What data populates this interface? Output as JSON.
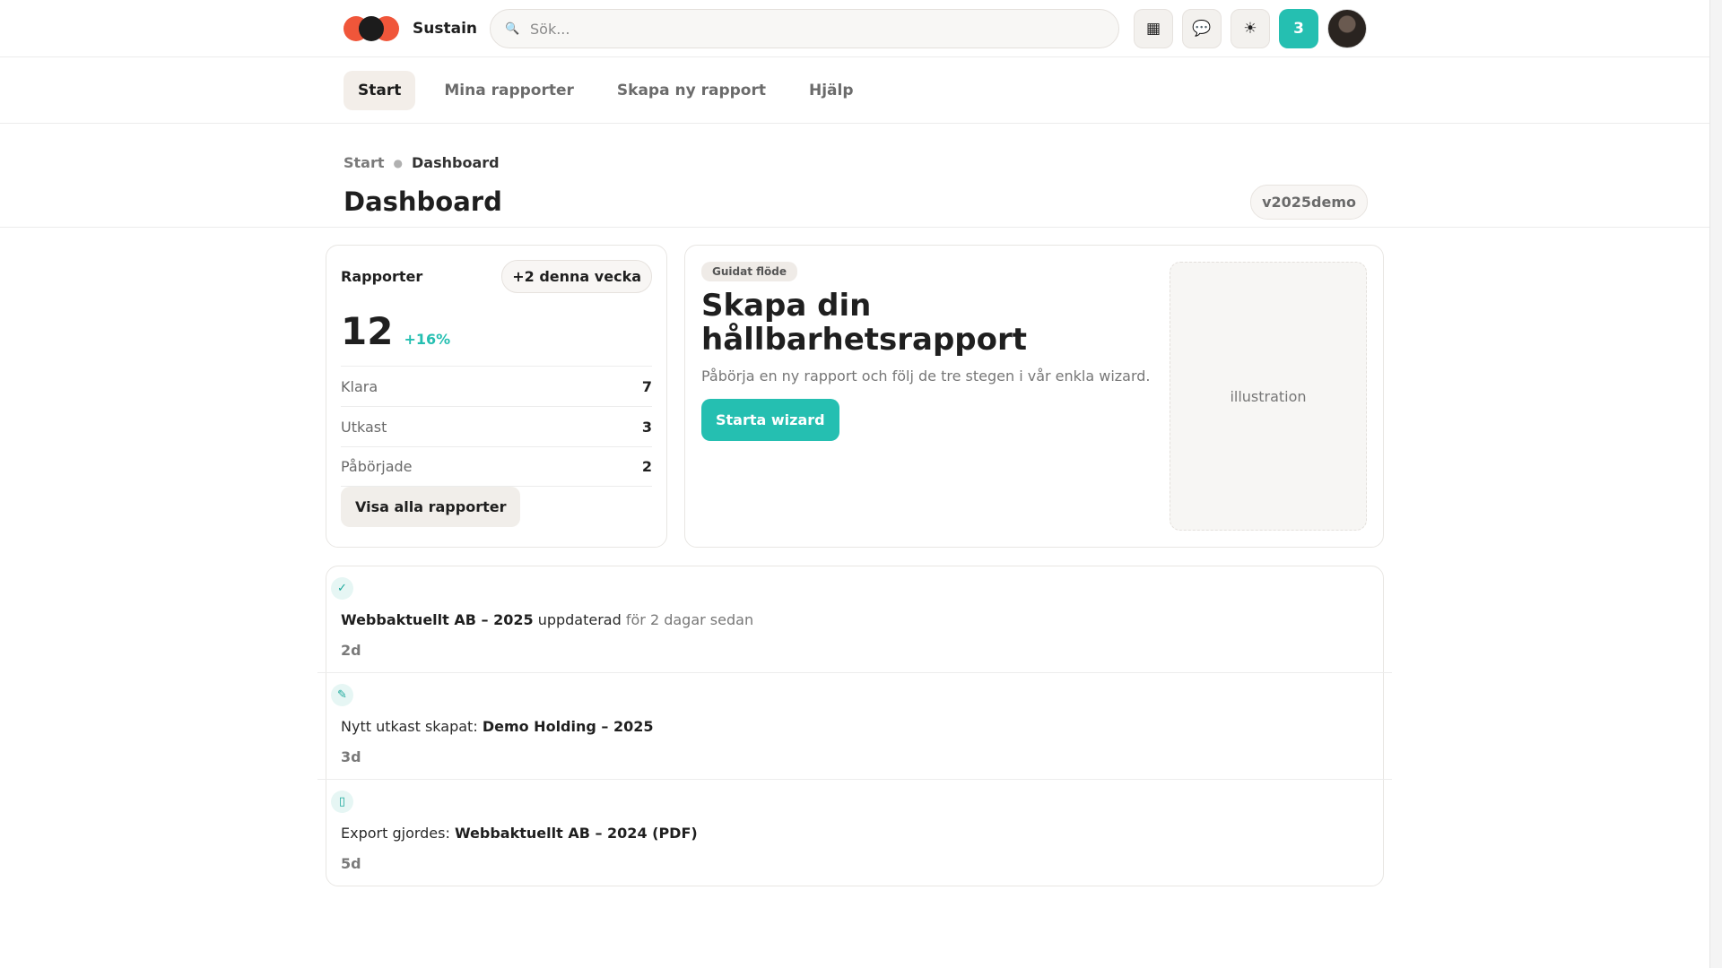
{
  "header": {
    "brand": "Sustain",
    "search_placeholder": "Sök...",
    "icons": [
      "calendar-icon",
      "chat-icon",
      "sun-icon"
    ],
    "notifications": "3"
  },
  "nav": {
    "tabs": [
      {
        "label": "Start",
        "active": true
      },
      {
        "label": "Mina rapporter",
        "active": false
      },
      {
        "label": "Skapa ny rapport",
        "active": false
      },
      {
        "label": "Hjälp",
        "active": false
      }
    ]
  },
  "page": {
    "breadcrumb": [
      "Start",
      "Dashboard"
    ],
    "title": "Dashboard",
    "version": "v2025demo"
  },
  "stats": {
    "title": "Rapporter",
    "week_badge": "+2 denna vecka",
    "total": "12",
    "delta": "+16%",
    "rows": [
      {
        "label": "Klara",
        "value": "7"
      },
      {
        "label": "Utkast",
        "value": "3"
      },
      {
        "label": "Påbörjade",
        "value": "2"
      }
    ],
    "button": "Visa alla rapporter"
  },
  "wizard": {
    "tag": "Guidat flöde",
    "title": "Skapa din hållbarhetsrapport",
    "description": "Påbörja en ny rapport och följ de tre stegen i vår enkla wizard.",
    "button": "Starta wizard",
    "illustration": "illustration"
  },
  "activity": [
    {
      "icon": "✓",
      "icon_name": "check-icon",
      "pre": "",
      "bold": "Webbaktuellt AB – 2025",
      "post": " uppdaterad ",
      "muted": "för 2 dagar sedan",
      "ago": "2d"
    },
    {
      "icon": "✎",
      "icon_name": "pencil-icon",
      "pre": "Nytt utkast skapat: ",
      "bold": "Demo Holding – 2025",
      "post": "",
      "muted": "",
      "ago": "3d"
    },
    {
      "icon": "▯",
      "icon_name": "document-icon",
      "pre": "Export gjordes: ",
      "bold": "Webbaktuellt AB – 2024 (PDF)",
      "post": "",
      "muted": "",
      "ago": "5d"
    }
  ],
  "colors": {
    "accent": "#25bfb1",
    "brand_orange": "#f0563a"
  }
}
